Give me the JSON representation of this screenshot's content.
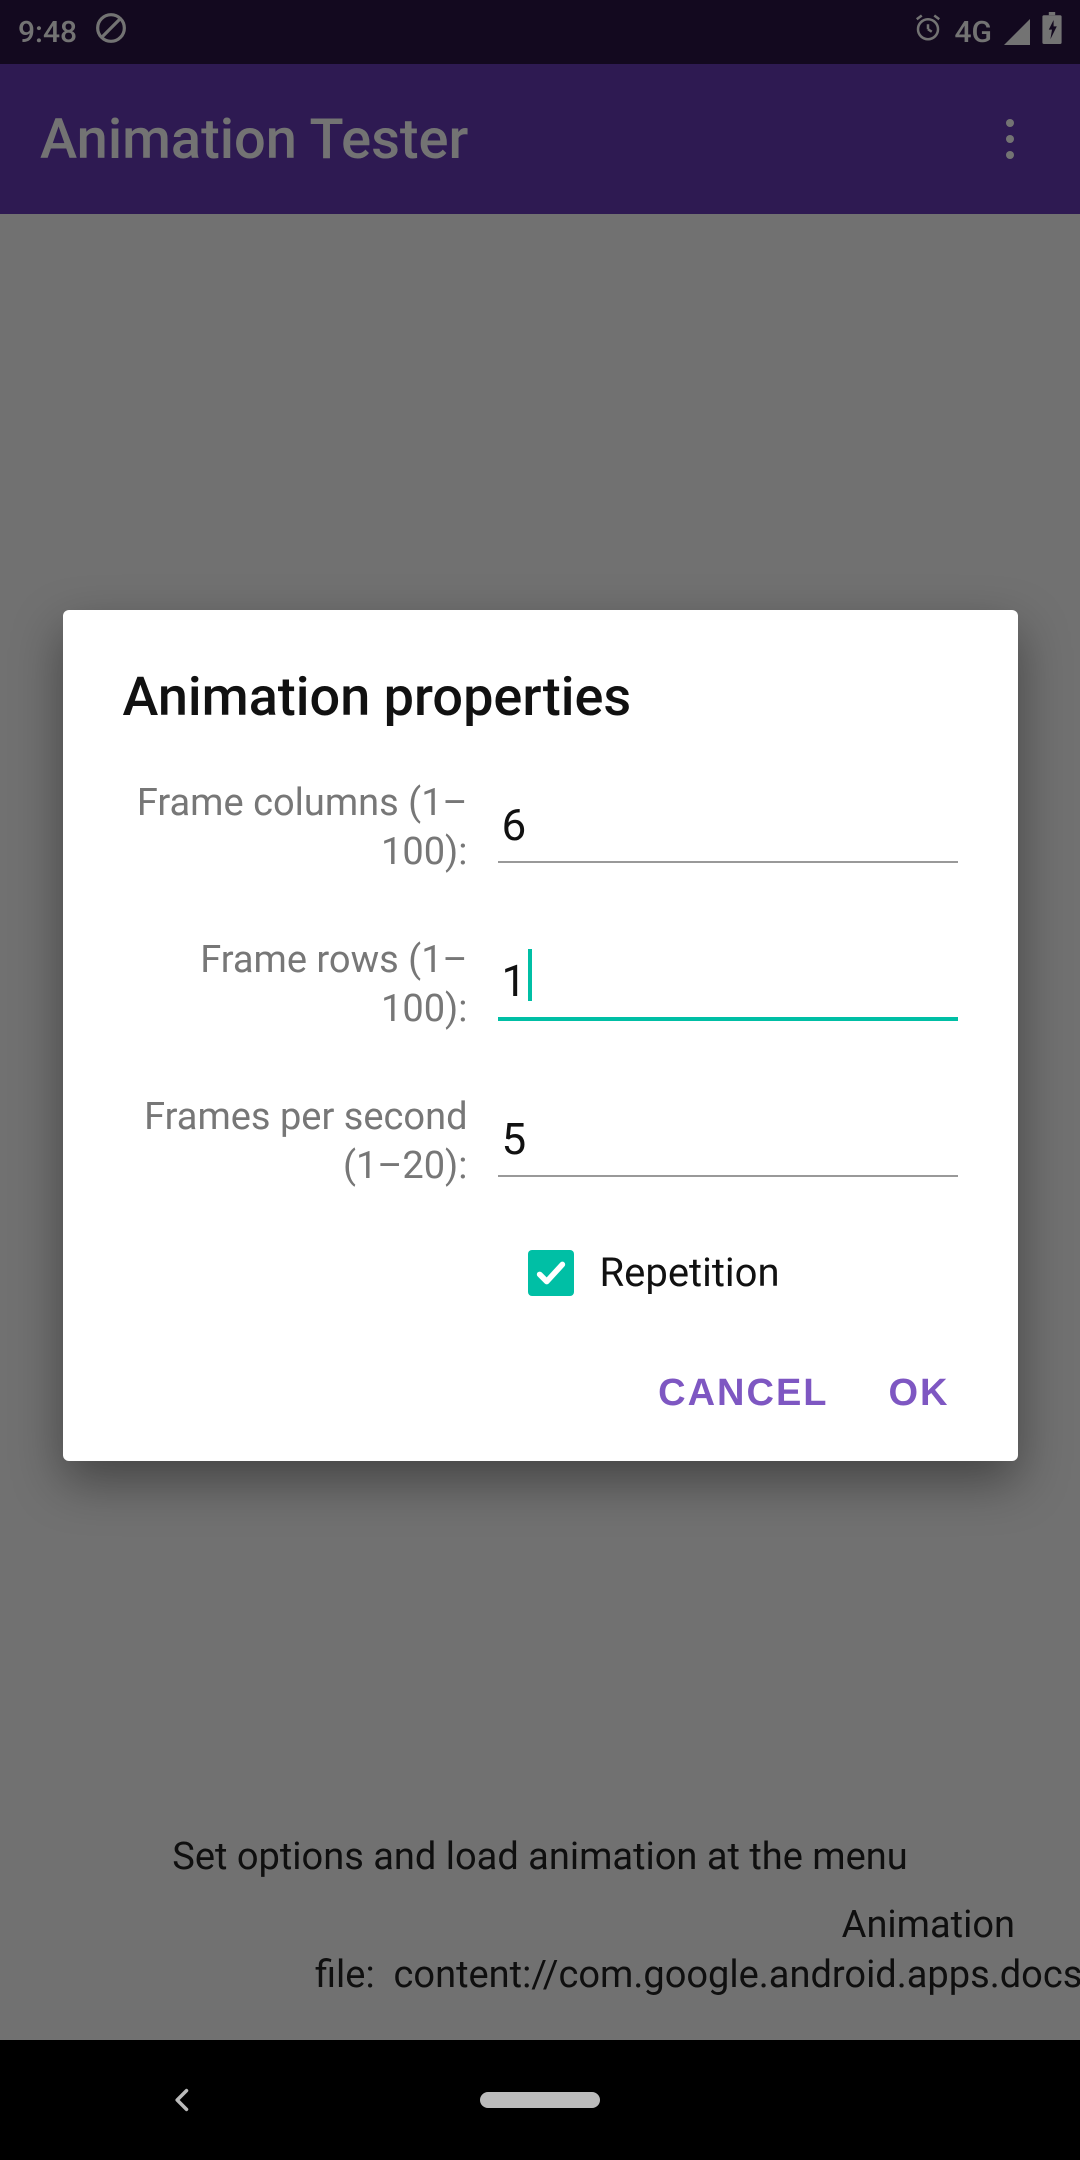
{
  "status_bar": {
    "time": "9:48",
    "network": "4G"
  },
  "app_bar": {
    "title": "Animation Tester"
  },
  "content": {
    "hint_line": "Set options and load animation at the menu",
    "file_label": "Animation file:",
    "file_value": "content://com.google.android.apps.docs.storage/document"
  },
  "dialog": {
    "title": "Animation properties",
    "fields": {
      "columns": {
        "label": "Frame columns (1–100):",
        "value": "6"
      },
      "rows": {
        "label": "Frame rows (1–100):",
        "value": "1"
      },
      "fps": {
        "label": "Frames per second (1–20):",
        "value": "5"
      }
    },
    "repetition": {
      "label": "Repetition",
      "checked": true
    },
    "actions": {
      "cancel": "Cancel",
      "ok": "OK"
    }
  }
}
